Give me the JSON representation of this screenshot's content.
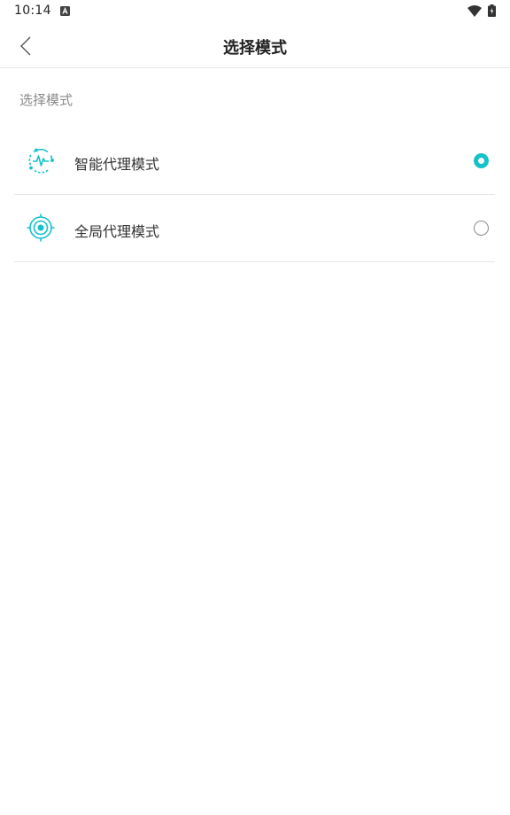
{
  "status_bar": {
    "time": "10:14",
    "notification_icon": "a-notification-icon",
    "wifi_icon": "wifi-icon",
    "battery_icon": "battery-charging-icon"
  },
  "header": {
    "title": "选择模式",
    "back_icon": "chevron-left-icon"
  },
  "section": {
    "label": "选择模式"
  },
  "options": [
    {
      "label": "智能代理模式",
      "icon": "pulse-circle-icon",
      "selected": true
    },
    {
      "label": "全局代理模式",
      "icon": "target-icon",
      "selected": false
    }
  ],
  "colors": {
    "accent": "#14c2c9",
    "divider": "#e6e6e6",
    "secondary_text": "#8a8a8a"
  }
}
